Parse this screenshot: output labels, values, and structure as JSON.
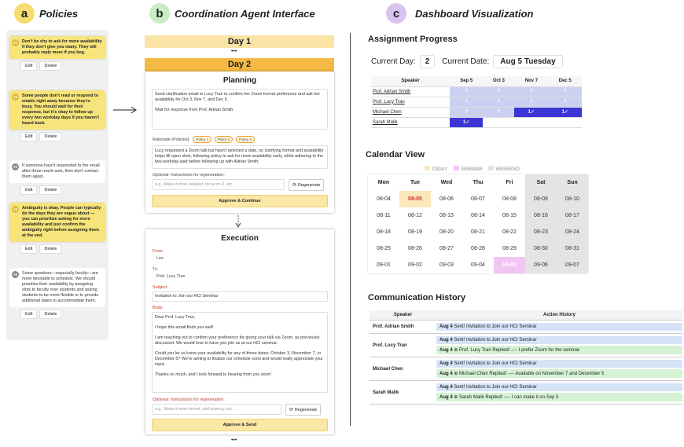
{
  "sections": {
    "a": {
      "letter": "a",
      "title": "Policies"
    },
    "b": {
      "letter": "b",
      "title": "Coordination Agent Interface"
    },
    "c": {
      "letter": "c",
      "title": "Dashboard Visualization"
    }
  },
  "colors": {
    "badge_a": "#f7dc6f",
    "badge_b": "#c9ecc4",
    "badge_c": "#d9c4ee",
    "highlight": "#f7e57b",
    "day_header": "#f4b942",
    "day1": "#fbe3a6",
    "approve": "#fbe7a6",
    "selected_cell": "#3b35d6",
    "weekend": "#e4e4e4",
    "seminar": "#f2c6f2",
    "today": "#fbe8b8",
    "sent": "#d5e3f7",
    "replied": "#d5f2d5"
  },
  "policies": [
    {
      "num": "#1",
      "highlight": true,
      "text": "Don't be shy to ask for more availability if they don't give you many. They will probably reply more if you beg.",
      "edit": "Edit",
      "delete": "Delete"
    },
    {
      "num": "#2",
      "highlight": true,
      "text": "Some people don't read or respond to emails right away because they're busy. You should wait for their response, but it's okay to follow up every two workday days if you haven't heard back.",
      "edit": "Edit",
      "delete": "Delete"
    },
    {
      "num": "#3",
      "highlight": false,
      "text": "If someone hasn't responded to the email after three reach-outs, then don't contact them again.",
      "edit": "Edit",
      "delete": "Delete"
    },
    {
      "num": "#4",
      "highlight": true,
      "text": "Ambiguity is okay. People can typically do the days they are vague about — you can prioritize asking for more availability and just confirm the ambiguity right before assigning them at the end.",
      "edit": "Edit",
      "delete": "Delete"
    },
    {
      "num": "#5",
      "highlight": false,
      "text": "Some speakers—especially faculty—are more desirable to schedule. We should prioritize their availability by assigning slots to faculty over students and asking students to be more flexible or to provide additional dates to accommodate them.",
      "edit": "Edit",
      "delete": "Delete"
    }
  ],
  "agent": {
    "day1": "Day 1",
    "dots": "•••",
    "day2": "Day 2",
    "planning": {
      "title": "Planning",
      "plan_text1": "Send clarification email to Lucy Tran to confirm her Zoom format preference and ask her availability for Oct 3, Nov 7, and Dec 5.",
      "plan_text2": "Wait for response from Prof. Adrian Smith.",
      "rationale_label": "Rationale (Policies):",
      "chips": [
        "Policy 1",
        "Policy 2",
        "Policy 4"
      ],
      "rationale_text": "Lucy requested a Zoom talk but hasn't selected a date, so clarifying format and availability helps fill open slots, following policy to ask for more availability early, while adhering to the two-workday wait before following up with Adrian Smith.",
      "regen_label": "Optional: Instructions for regeneration:",
      "regen_placeholder": "e.g., Make it more detailed, focus on X, etc.",
      "regen_button": "Regenerate",
      "approve": "Approve & Continue"
    },
    "execution": {
      "title": "Execution",
      "from_label": "From:",
      "from": "Lee",
      "to_label": "To:",
      "to": "Prof. Lucy Tran",
      "subject_label": "Subject:",
      "subject": "Invitation to Join our HCI Seminar",
      "body_label": "Body:",
      "body": [
        "Dear Prof. Lucy Tran,",
        "I hope this email finds you well!",
        "I am reaching out to confirm your preference for giving your talk via Zoom, as previously discussed. We would love to have you join us at our HCI seminar.",
        "Could you let us know your availability for any of these dates: October 3, November 7, or December 5? We're aiming to finalize our schedule soon and would really appreciate your input.",
        "Thanks so much, and I look forward to hearing from you soon!"
      ],
      "regen_label": "Optional: Instructions for regeneration:",
      "regen_placeholder": "e.g., Make it more formal, add urgency, etc.",
      "regen_button": "Regenerate",
      "approve": "Approve & Send"
    },
    "bottom_dots": "•••"
  },
  "dashboard": {
    "assignment": {
      "title": "Assignment Progress",
      "current_day_label": "Current Day:",
      "current_day": "2",
      "current_date_label": "Current Date:",
      "current_date": "Aug 5 Tuesday",
      "headers": [
        "Speaker",
        "Sep 5",
        "Oct 3",
        "Nov 7",
        "Dec 5"
      ],
      "rows": [
        {
          "speaker": "Prof. Adrian Smith",
          "cells": [
            "?",
            "?",
            "?",
            "?"
          ]
        },
        {
          "speaker": "Prof. Lucy Tran",
          "cells": [
            "?",
            "?",
            "?",
            "?"
          ]
        },
        {
          "speaker": "Michael Chen",
          "cells": [
            "?",
            "?",
            "1✓",
            "1✓"
          ]
        },
        {
          "speaker": "Sarah Malik",
          "cells": [
            "1✓",
            "",
            "",
            ""
          ]
        }
      ]
    },
    "calendar": {
      "title": "Calendar View",
      "legend": [
        "TODAY",
        "SEMINAR",
        "WEEKEND"
      ],
      "headers": [
        "Mon",
        "Tue",
        "Wed",
        "Thu",
        "Fri",
        "Sat",
        "Sun"
      ],
      "weeks": [
        [
          "08-04",
          "08-05",
          "08-06",
          "08-07",
          "08-08",
          "08-09",
          "08-10"
        ],
        [
          "08-11",
          "08-12",
          "08-13",
          "08-14",
          "08-15",
          "08-16",
          "08-17"
        ],
        [
          "08-18",
          "08-19",
          "08-20",
          "08-21",
          "08-22",
          "08-23",
          "08-24"
        ],
        [
          "08-25",
          "08-26",
          "08-27",
          "08-28",
          "08-29",
          "08-30",
          "08-31"
        ],
        [
          "09-01",
          "09-02",
          "09-03",
          "09-04",
          "09-05",
          "09-06",
          "09-07"
        ]
      ]
    },
    "history": {
      "title": "Communication History",
      "headers": [
        "Speaker",
        "Action History"
      ],
      "rows": [
        {
          "speaker": "Prof. Adrian Smith",
          "msgs": [
            {
              "date": "Aug 4",
              "type": "sent",
              "text": "Sent! Invitation to Join our HCI Seminar"
            }
          ]
        },
        {
          "speaker": "Prof. Lucy Tran",
          "msgs": [
            {
              "date": "Aug 4",
              "type": "sent",
              "text": "Sent! Invitation to Join our HCI Seminar"
            },
            {
              "date": "Aug 4",
              "type": "replied",
              "text": "⊕ Prof. Lucy Tran Replied! ---- I prefer Zoom for the seminar"
            }
          ]
        },
        {
          "speaker": "Michael Chen",
          "msgs": [
            {
              "date": "Aug 4",
              "type": "sent",
              "text": "Sent! Invitation to Join our HCI Seminar"
            },
            {
              "date": "Aug 4",
              "type": "replied",
              "text": "⊕ Michael Chen Replied! ---- Available on November 7 and December 5"
            }
          ]
        },
        {
          "speaker": "Sarah Malik",
          "msgs": [
            {
              "date": "Aug 4",
              "type": "sent",
              "text": "Sent! Invitation to Join our HCI Seminar"
            },
            {
              "date": "Aug 4",
              "type": "replied",
              "text": "⊕ Sarah Malik Replied! ---- I can make it on Sep 5"
            }
          ]
        }
      ]
    }
  }
}
